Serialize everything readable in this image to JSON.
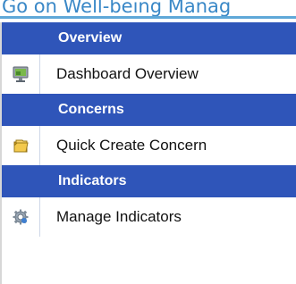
{
  "page": {
    "title_fragment": "Go on Well-being Manag"
  },
  "menu": {
    "sections": [
      {
        "header": "Overview",
        "item": {
          "label": "Dashboard Overview",
          "icon": "dashboard-monitor-icon"
        }
      },
      {
        "header": "Concerns",
        "item": {
          "label": "Quick Create Concern",
          "icon": "folder-icon"
        }
      },
      {
        "header": "Indicators",
        "item": {
          "label": "Manage Indicators",
          "icon": "gear-icon"
        }
      }
    ]
  },
  "colors": {
    "header_bg": "#2f55b9",
    "title_text": "#3a88c7",
    "accent_line": "#5fa8d8"
  }
}
